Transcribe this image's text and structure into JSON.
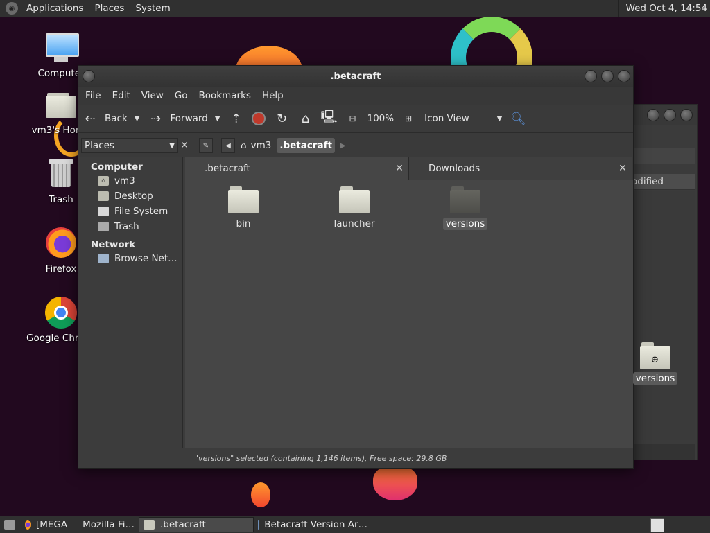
{
  "top_panel": {
    "menus": [
      "Applications",
      "Places",
      "System"
    ],
    "clock": "Wed Oct  4, 14:54"
  },
  "desktop": {
    "icons": [
      {
        "label": "Computer",
        "icon": "computer-icon"
      },
      {
        "label": "vm3's Home",
        "icon": "home-folder-icon"
      },
      {
        "label": "Trash",
        "icon": "trash-icon"
      },
      {
        "label": "Firefox",
        "icon": "firefox-icon"
      },
      {
        "label": "Google Chrome",
        "icon": "chrome-icon"
      }
    ]
  },
  "window": {
    "title": ".betacraft",
    "menus": [
      "File",
      "Edit",
      "View",
      "Go",
      "Bookmarks",
      "Help"
    ],
    "toolbar": {
      "back_label": "Back",
      "forward_label": "Forward",
      "zoom": "100%",
      "view_mode": "Icon View"
    },
    "sidebar": {
      "selector_label": "Places",
      "sections": [
        {
          "title": "Computer",
          "items": [
            "vm3",
            "Desktop",
            "File System",
            "Trash"
          ]
        },
        {
          "title": "Network",
          "items": [
            "Browse Net…"
          ]
        }
      ]
    },
    "breadcrumbs": [
      "vm3",
      ".betacraft"
    ],
    "tabs": [
      {
        "label": ".betacraft",
        "active": true
      },
      {
        "label": "Downloads",
        "active": false
      }
    ],
    "files": [
      {
        "name": "bin",
        "selected": false
      },
      {
        "name": "launcher",
        "selected": false
      },
      {
        "name": "versions",
        "selected": true
      }
    ],
    "status": "\"versions\" selected (containing 1,146 items), Free space: 29.8 GB"
  },
  "back_window": {
    "column_header": "odified"
  },
  "drag_item": {
    "label": "versions"
  },
  "taskbar": {
    "tasks": [
      {
        "label": "[MEGA — Mozilla Fi…",
        "icon": "firefox-icon",
        "active": false
      },
      {
        "label": ".betacraft",
        "icon": "folder-icon",
        "active": true
      },
      {
        "label": "Betacraft Version Ar…",
        "icon": "app-icon",
        "active": false
      }
    ]
  }
}
